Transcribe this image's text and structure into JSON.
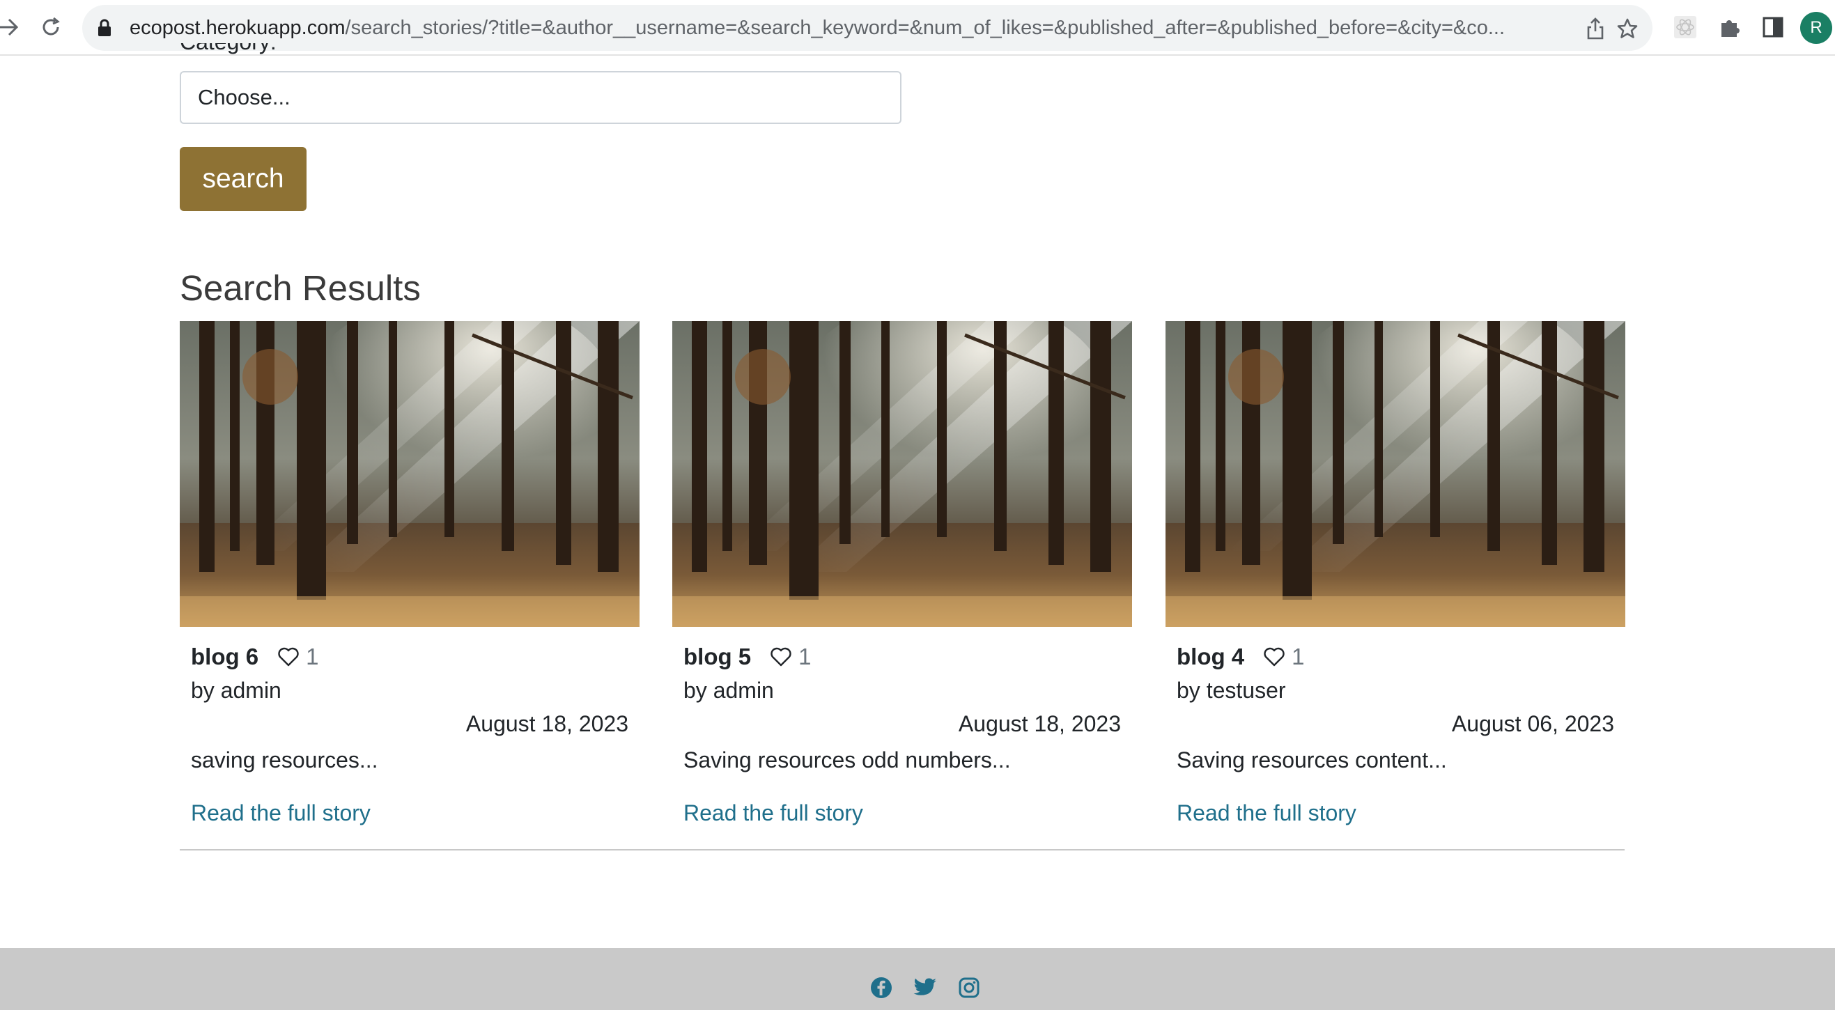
{
  "browser": {
    "url_host": "ecopost.herokuapp.com",
    "url_path": "/search_stories/?title=&author__username=&search_keyword=&num_of_likes=&published_after=&published_before=&city=&co...",
    "profile_initial": "R"
  },
  "form": {
    "category_label": "Category:",
    "category_value": "Choose...",
    "search_button": "search"
  },
  "results": {
    "heading": "Search Results",
    "cards": [
      {
        "title": "blog 6",
        "likes": "1",
        "author": "by admin",
        "date": "August 18, 2023",
        "excerpt": "saving resources...",
        "link": "Read the full story"
      },
      {
        "title": "blog 5",
        "likes": "1",
        "author": "by admin",
        "date": "August 18, 2023",
        "excerpt": "Saving resources odd numbers...",
        "link": "Read the full story"
      },
      {
        "title": "blog 4",
        "likes": "1",
        "author": "by testuser",
        "date": "August 06, 2023",
        "excerpt": "Saving resources content...",
        "link": "Read the full story"
      }
    ]
  },
  "footer": {
    "social_icons": [
      "facebook-icon",
      "twitter-icon",
      "instagram-icon"
    ],
    "icon_color": "#1f6f8b"
  },
  "colors": {
    "accent_button": "#8e7234",
    "link": "#1f6f8b",
    "footer_bg": "#c9c9c9"
  }
}
